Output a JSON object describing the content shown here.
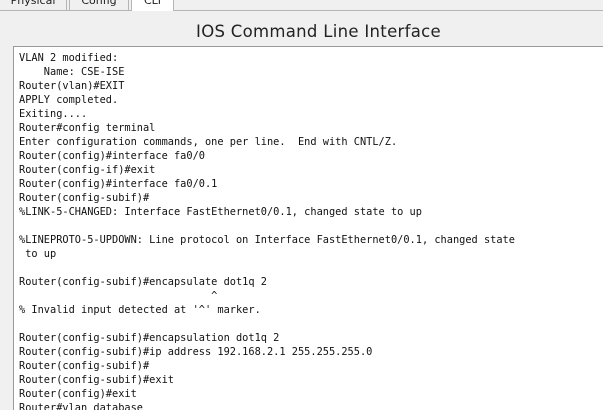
{
  "tabs": [
    {
      "label": "Physical"
    },
    {
      "label": "Config"
    },
    {
      "label": "CLI"
    }
  ],
  "title": "IOS Command Line Interface",
  "terminal": {
    "lines": [
      "VLAN 2 modified:",
      "    Name: CSE-ISE",
      "Router(vlan)#EXIT",
      "APPLY completed.",
      "Exiting....",
      "Router#config terminal",
      "Enter configuration commands, one per line.  End with CNTL/Z.",
      "Router(config)#interface fa0/0",
      "Router(config-if)#exit",
      "Router(config)#interface fa0/0.1",
      "Router(config-subif)#",
      "%LINK-5-CHANGED: Interface FastEthernet0/0.1, changed state to up",
      "",
      "%LINEPROTO-5-UPDOWN: Line protocol on Interface FastEthernet0/0.1, changed state",
      " to up",
      "",
      "Router(config-subif)#encapsulate dot1q 2",
      "                               ^",
      "% Invalid input detected at '^' marker.",
      "",
      "Router(config-subif)#encapsulation dot1q 2",
      "Router(config-subif)#ip address 192.168.2.1 255.255.255.0",
      "Router(config-subif)#",
      "Router(config-subif)#exit",
      "Router(config)#exit",
      "Router#vlan database"
    ]
  }
}
